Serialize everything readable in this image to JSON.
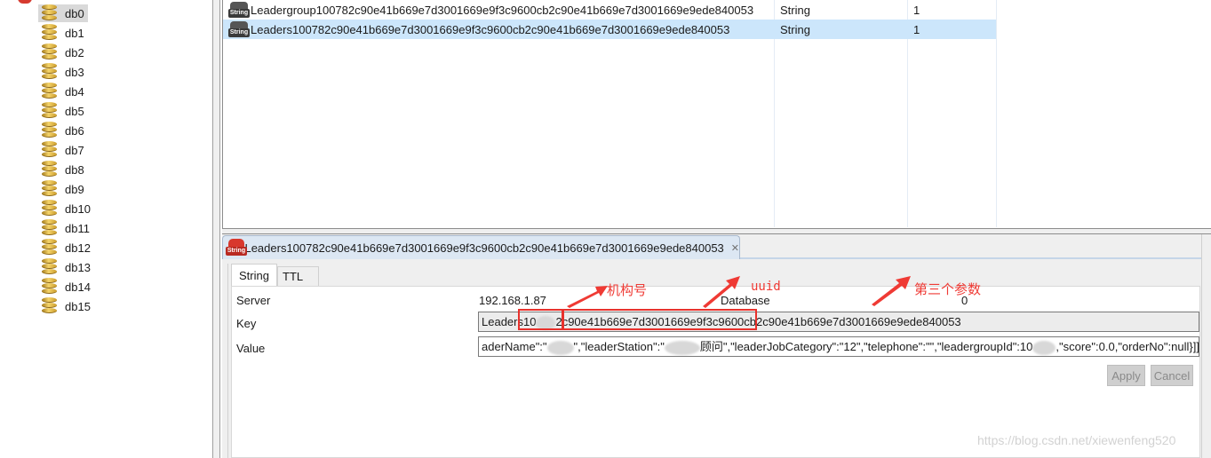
{
  "sidebar": {
    "databases": [
      {
        "label": "db0",
        "selected": true
      },
      {
        "label": "db1"
      },
      {
        "label": "db2"
      },
      {
        "label": "db3"
      },
      {
        "label": "db4"
      },
      {
        "label": "db5"
      },
      {
        "label": "db6"
      },
      {
        "label": "db7"
      },
      {
        "label": "db8"
      },
      {
        "label": "db9"
      },
      {
        "label": "db10"
      },
      {
        "label": "db11"
      },
      {
        "label": "db12"
      },
      {
        "label": "db13"
      },
      {
        "label": "db14"
      },
      {
        "label": "db15"
      }
    ]
  },
  "key_table": {
    "rows": [
      {
        "icon": "String",
        "key": "Leadergroup100782c90e41b669e7d3001669e9f3c9600cb2c90e41b669e7d3001669e9ede840053",
        "type": "String",
        "size": "1",
        "selected": false
      },
      {
        "icon": "String",
        "key": "Leaders100782c90e41b669e7d3001669e9f3c9600cb2c90e41b669e7d3001669e9ede840053",
        "type": "String",
        "size": "1",
        "selected": true
      }
    ]
  },
  "editor": {
    "tab_title": "Leaders100782c90e41b669e7d3001669e9f3c9600cb2c90e41b669e7d3001669e9ede840053",
    "tab_icon_label": "String",
    "close_glyph": "✕",
    "subtabs": [
      "String",
      "TTL"
    ],
    "server_label": "Server",
    "server_value": "192.168.1.87",
    "database_label": "Database",
    "database_value": "0",
    "key_label": "Key",
    "key_value_prefix": "Leaders",
    "key_value_part1": "10",
    "key_value_part1_end": "2",
    "key_value_uuid": "90e41b669e7d3001669e9f3c9600cb2",
    "key_value_rest": "90e41b669e7d3001669e9ede840053",
    "value_label": "Value",
    "value_seg1": "aderName\":\"",
    "value_seg2": "\",\"leaderStation\":\"",
    "value_seg3": "顾问\",\"leaderJobCategory\":\"12\",\"telephone\":\"\",\"leadergroupId\":10",
    "value_seg4": ",\"score\":0.0,\"orderNo\":null}]]]",
    "apply_label": "Apply",
    "cancel_label": "Cancel"
  },
  "annotations": {
    "org_code": "机构号",
    "uuid": "uuid",
    "third_param": "第三个参数",
    "color": "#e8312c"
  },
  "watermark": "https://blog.csdn.net/xiewenfeng520"
}
